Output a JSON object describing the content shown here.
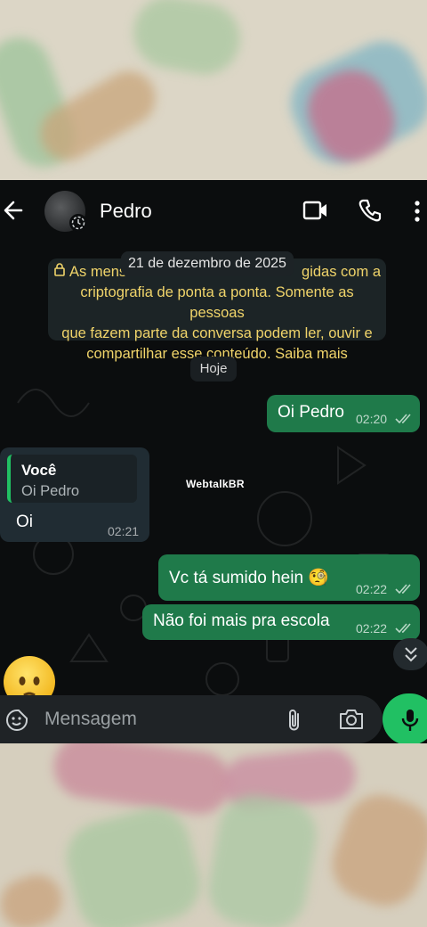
{
  "header": {
    "contact_name": "Pedro",
    "back_icon": "arrow-left-icon",
    "video_icon": "video-call-icon",
    "call_icon": "phone-icon",
    "menu_icon": "more-vert-icon"
  },
  "chat": {
    "date_label": "21 de dezembro de 2025",
    "encryption_notice": {
      "line1": "As mens",
      "line1_end": "gidas com a",
      "line2": "criptografia de ponta a ponta. Somente as pessoas",
      "line3": "que fazem parte da conversa podem ler, ouvir e",
      "line4": "compartilhar esse conteúdo. Saiba mais"
    },
    "today_label": "Hoje",
    "messages": [
      {
        "direction": "out",
        "text": "Oi Pedro",
        "time": "02:20",
        "status": "read"
      },
      {
        "direction": "in",
        "quote_author": "Você",
        "quote_text": "Oi Pedro",
        "text": "Oi",
        "time": "02:21"
      },
      {
        "direction": "out",
        "text": "Vc tá sumido hein 🧐",
        "time": "02:22",
        "status": "read"
      },
      {
        "direction": "out",
        "text": "Não foi mais pra escola",
        "time": "02:22",
        "status": "read"
      }
    ],
    "watermark": "WebtalkBR"
  },
  "composer": {
    "placeholder": "Mensagem",
    "sticker_icon": "sticker-icon",
    "attach_icon": "paperclip-icon",
    "camera_icon": "camera-icon",
    "mic_icon": "microphone-icon"
  },
  "colors": {
    "accent": "#21c063",
    "outgoing_bubble": "#1f7a4a",
    "incoming_bubble": "#202c33",
    "encryption_text": "#f0d46a"
  }
}
